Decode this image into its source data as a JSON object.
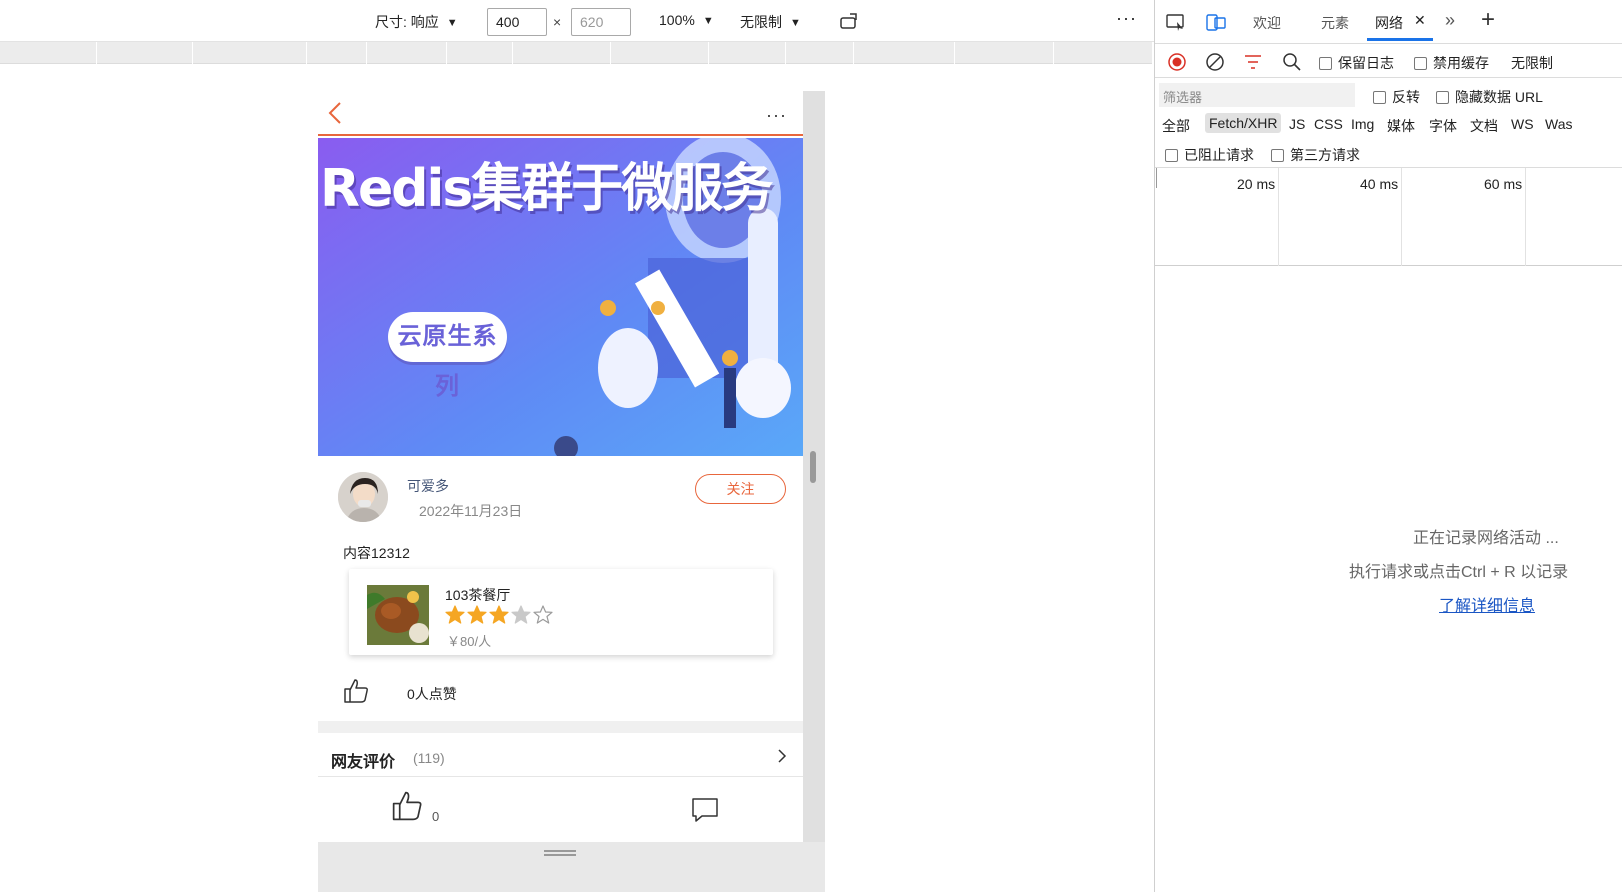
{
  "device_toolbar": {
    "dimensions_label": "尺寸: 响应",
    "width_value": "400",
    "height_placeholder": "620",
    "times": "×",
    "zoom": "100%",
    "throttle": "无限制",
    "more": "···"
  },
  "page": {
    "banner": {
      "title": "Redis集群于微服务",
      "pill": "云原生系列"
    },
    "author": {
      "name": "可爱多",
      "date": "2022年11月23日",
      "follow_label": "关注"
    },
    "content": "内容12312",
    "shop": {
      "name": "103茶餐厅",
      "rating": 3.5,
      "rating_max": 5,
      "price": "￥80/人"
    },
    "likes": "0人点赞",
    "reviews": {
      "title": "网友评价",
      "count": "(119)"
    },
    "bottom_bar": {
      "like_count": "0"
    }
  },
  "devtools": {
    "tabs": {
      "welcome": "欢迎",
      "elements": "元素",
      "network": "网络"
    },
    "toolbar": {
      "preserve_log": "保留日志",
      "disable_cache": "禁用缓存",
      "throttle": "无限制"
    },
    "filter": {
      "placeholder": "筛选器",
      "invert": "反转",
      "hide_data_urls": "隐藏数据 URL"
    },
    "types": [
      "全部",
      "Fetch/XHR",
      "JS",
      "CSS",
      "Img",
      "媒体",
      "字体",
      "文档",
      "WS",
      "Was"
    ],
    "blocked": "已阻止请求",
    "third_party": "第三方请求",
    "timeline_labels": [
      "20 ms",
      "40 ms",
      "60 ms"
    ],
    "empty": {
      "line1": "正在记录网络活动 ...",
      "line2": "执行请求或点击Ctrl + R 以记录",
      "link": "了解详细信息"
    }
  }
}
